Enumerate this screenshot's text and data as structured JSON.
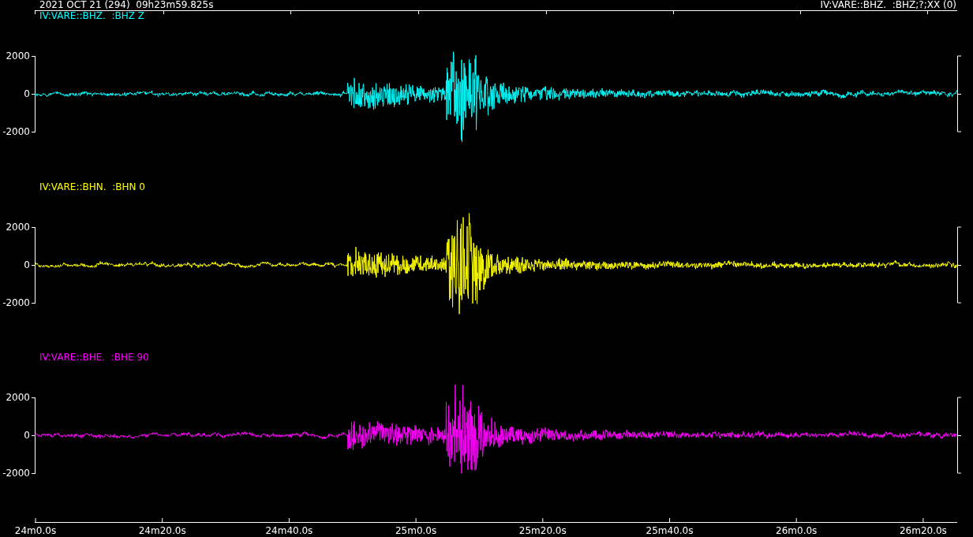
{
  "header": {
    "datetime": "2021 OCT 21 (294)  09h23m59.825s",
    "station_info": "IV:VARE::BHZ.  :BHZ;?;XX (0)"
  },
  "traces": [
    {
      "label": "IV:VARE::BHZ.  :BHZ Z",
      "color": "#00ffff",
      "y_ticks": [
        "2000",
        "0",
        "-2000"
      ]
    },
    {
      "label": "IV:VARE::BHN.  :BHN 0",
      "color": "#ffff00",
      "y_ticks": [
        "2000",
        "0",
        "-2000"
      ]
    },
    {
      "label": "IV:VARE::BHE.  :BHE 90",
      "color": "#ff00ff",
      "y_ticks": [
        "2000",
        "0",
        "-2000"
      ]
    }
  ],
  "time_axis": {
    "labels": [
      "24m0.0s",
      "24m20.0s",
      "24m40.0s",
      "25m0.0s",
      "25m20.0s",
      "25m40.0s",
      "26m0.0s",
      "26m20.0s"
    ]
  }
}
